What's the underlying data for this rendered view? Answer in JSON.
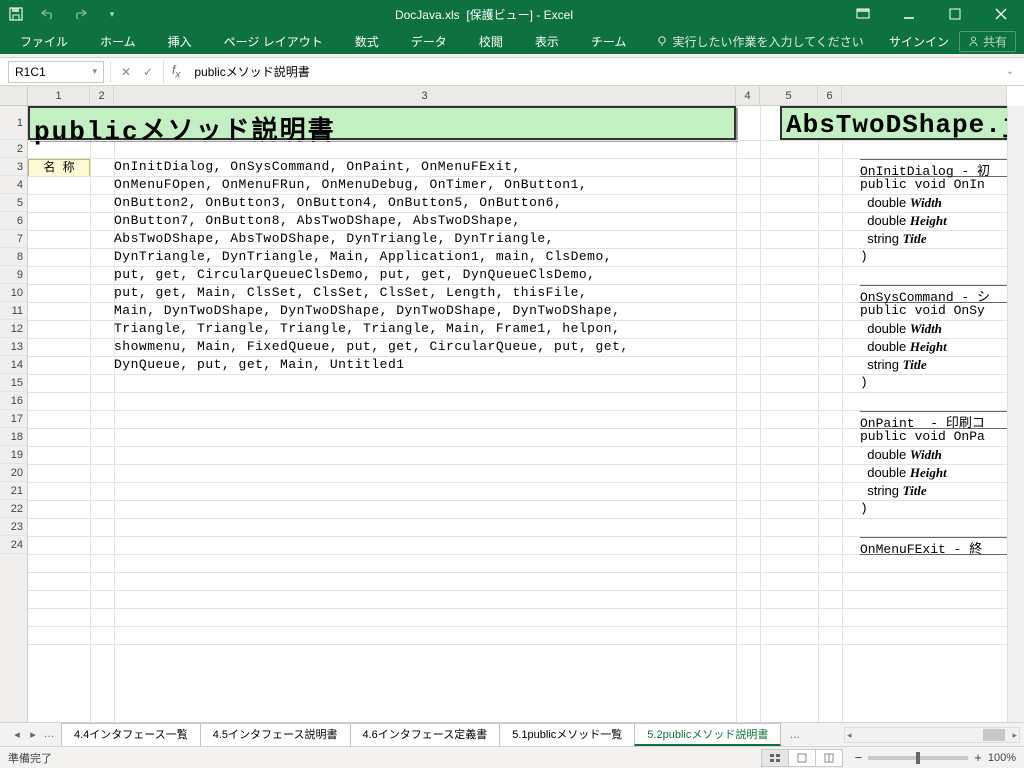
{
  "title": {
    "filename": "DocJava.xls",
    "suffix": "[保護ビュー] - Excel"
  },
  "ribbon": {
    "tabs": [
      "ファイル",
      "ホーム",
      "挿入",
      "ページ レイアウト",
      "数式",
      "データ",
      "校閲",
      "表示",
      "チーム"
    ],
    "tellme": "実行したい作業を入力してください",
    "signin": "サインイン",
    "share": "共有"
  },
  "formulabar": {
    "namebox": "R1C1",
    "formula": "publicメソッド説明書"
  },
  "colnums": [
    "1",
    "2",
    "3",
    "4",
    "5",
    "6"
  ],
  "rownums": [
    "1",
    "2",
    "3",
    "4",
    "5",
    "6",
    "7",
    "8",
    "9",
    "10",
    "11",
    "12",
    "13",
    "14",
    "15",
    "16",
    "17",
    "18",
    "19",
    "20",
    "21",
    "22",
    "23",
    "24"
  ],
  "cells": {
    "title1": "publicメソッド説明書",
    "title2": "AbsTwoDShape.j",
    "name_label": "名 称",
    "code": [
      "OnInitDialog, OnSysCommand, OnPaint, OnMenuFExit,",
      "OnMenuFOpen, OnMenuFRun, OnMenuDebug, OnTimer, OnButton1,",
      "OnButton2, OnButton3, OnButton4, OnButton5, OnButton6,",
      "OnButton7, OnButton8, AbsTwoDShape, AbsTwoDShape,",
      "AbsTwoDShape, AbsTwoDShape, DynTriangle, DynTriangle,",
      "DynTriangle, DynTriangle, Main, Application1, main, ClsDemo,",
      "put, get, CircularQueueClsDemo, put, get, DynQueueClsDemo,",
      "put, get, Main, ClsSet, ClsSet, ClsSet, Length, thisFile,",
      "Main, DynTwoDShape, DynTwoDShape, DynTwoDShape, DynTwoDShape,",
      "Triangle, Triangle, Triangle, Triangle, Main, Frame1, helpon,",
      "showmenu, Main, FixedQueue, put, get, CircularQueue, put, get,",
      "DynQueue, put, get, Main, Untitled1"
    ],
    "right": [
      {
        "t": "OnInitDialog - 初",
        "sep": true
      },
      {
        "t": "public void OnIn"
      },
      {
        "t": "  double ",
        "it": "Width"
      },
      {
        "t": "  double ",
        "it": "Height"
      },
      {
        "t": "  string ",
        "it": "Title"
      },
      {
        "t": ")"
      },
      {
        "t": "",
        "blank": true
      },
      {
        "t": "OnSysCommand - シ",
        "sep": true
      },
      {
        "t": "public void OnSy"
      },
      {
        "t": "  double ",
        "it": "Width"
      },
      {
        "t": "  double ",
        "it": "Height"
      },
      {
        "t": "  string ",
        "it": "Title"
      },
      {
        "t": ")"
      },
      {
        "t": "",
        "blank": true
      },
      {
        "t": "OnPaint  - 印刷コ",
        "sep": true
      },
      {
        "t": "public void OnPa"
      },
      {
        "t": "  double ",
        "it": "Width"
      },
      {
        "t": "  double ",
        "it": "Height"
      },
      {
        "t": "  string ",
        "it": "Title"
      },
      {
        "t": ")"
      },
      {
        "t": "",
        "blank": true
      },
      {
        "t": "OnMenuFExit - 終",
        "sep": true
      }
    ]
  },
  "sheets": {
    "tabs": [
      "4.4インタフェース一覧",
      "4.5インタフェース説明書",
      "4.6インタフェース定義書",
      "5.1publicメソッド一覧",
      "5.2publicメソッド説明書"
    ],
    "active": 4
  },
  "status": {
    "ready": "準備完了",
    "zoom": "100%"
  }
}
